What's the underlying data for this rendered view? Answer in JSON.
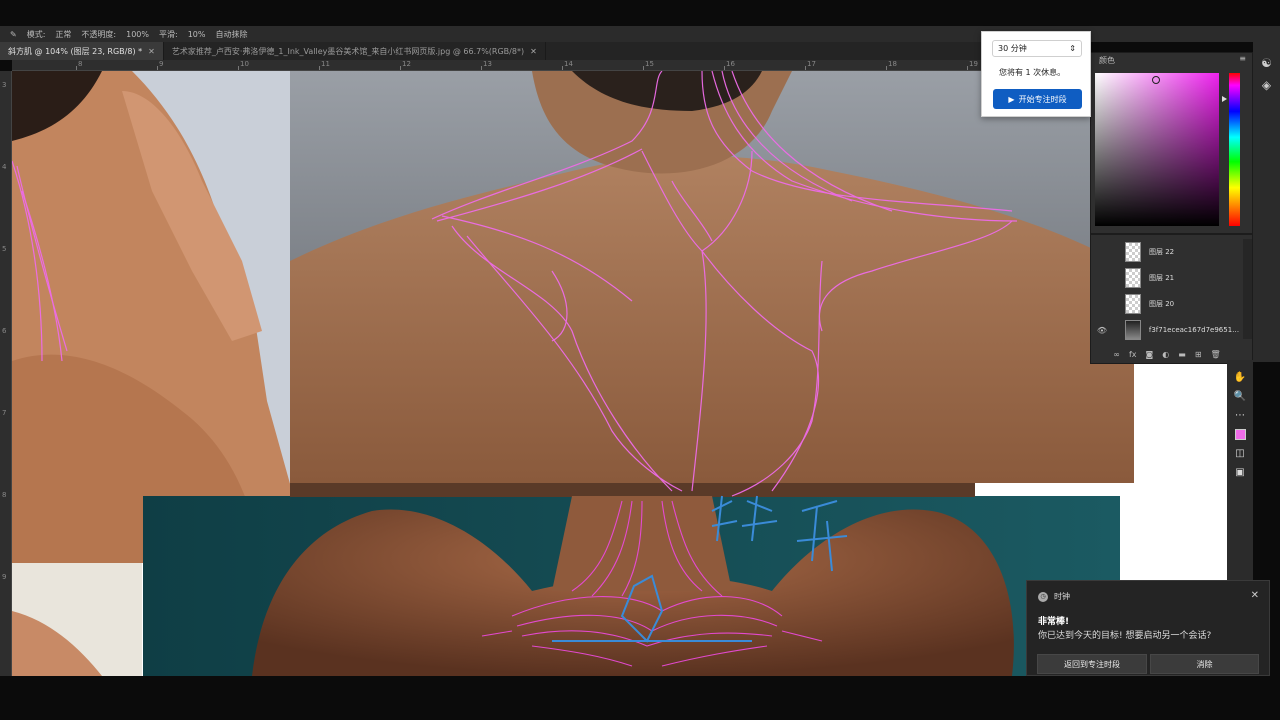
{
  "optbar": {
    "items": [
      "模式:",
      "正常",
      "不透明度:",
      "100%",
      "平滑:",
      "10%",
      "自动抹除"
    ]
  },
  "tabs": [
    {
      "label": "斜方肌 @ 104% (图层 23, RGB/8) *",
      "active": true
    },
    {
      "label": "艺术家推荐_卢西安·弗洛伊德_1_Ink_Valley墨谷美术馆_来自小红书网页版.jpg @ 66.7%(RGB/8*)",
      "active": false
    }
  ],
  "ruler": {
    "h_ticks": [
      "8",
      "9",
      "10",
      "11",
      "12",
      "13",
      "14",
      "15",
      "16",
      "17",
      "18",
      "19"
    ],
    "v_ticks": [
      "3",
      "4",
      "5",
      "6",
      "7",
      "8",
      "9"
    ]
  },
  "color_panel": {
    "title": "颜色"
  },
  "layers": [
    {
      "name": "图层 22",
      "visible": false
    },
    {
      "name": "图层 21",
      "visible": false
    },
    {
      "name": "图层 20",
      "visible": false
    },
    {
      "name": "f3f71eceac167d7e96514...",
      "visible": true
    }
  ],
  "focus_popup": {
    "duration": "30 分钟",
    "note": "您将有 1 次休息。",
    "start_label": "开始专注时段"
  },
  "toast": {
    "app_name": "时钟",
    "heading": "非常棒!",
    "body": "你已达到今天的目标! 想要启动另一个会话?",
    "button_return": "返回到专注时段",
    "button_dismiss": "消除"
  },
  "canvas_annotation": "斜方肌",
  "colors": {
    "brush": "#ee6ce8",
    "focus_blue": "#0f5dc2"
  }
}
